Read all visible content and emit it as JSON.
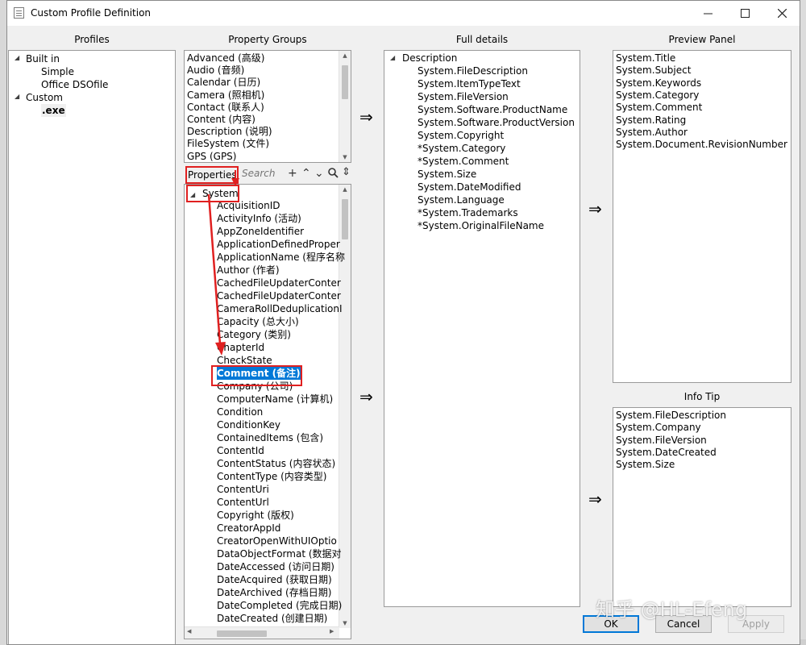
{
  "window": {
    "title": "Custom Profile Definition"
  },
  "columns": {
    "profiles": "Profiles",
    "property_groups": "Property Groups",
    "full_details": "Full details",
    "preview_panel": "Preview Panel",
    "info_tip": "Info Tip"
  },
  "profiles_tree": {
    "built_in": "Built in",
    "simple": "Simple",
    "office": "Office DSOfile",
    "custom": "Custom",
    "exe": ".exe"
  },
  "property_groups": [
    "Advanced (高级)",
    "Audio (音频)",
    "Calendar (日历)",
    "Camera (照相机)",
    "Contact (联系人)",
    "Content (内容)",
    "Description (说明)",
    "FileSystem (文件)",
    "GPS (GPS)"
  ],
  "properties_label": "Properties",
  "search_placeholder": "Search",
  "properties_tree": {
    "root": "System",
    "items": [
      "AcquisitionID",
      "ActivityInfo (活动)",
      "AppZoneIdentifier",
      "ApplicationDefinedProper",
      "ApplicationName (程序名称",
      "Author (作者)",
      "CachedFileUpdaterConter",
      "CachedFileUpdaterConter",
      "CameraRollDeduplicationI",
      "Capacity (总大小)",
      "Category (类别)",
      "ChapterId",
      "CheckState",
      "Comment (备注)",
      "Company (公司)",
      "ComputerName (计算机)",
      "Condition",
      "ConditionKey",
      "ContainedItems (包含)",
      "ContentId",
      "ContentStatus (内容状态)",
      "ContentType (内容类型)",
      "ContentUri",
      "ContentUrl",
      "Copyright (版权)",
      "CreatorAppId",
      "CreatorOpenWithUIOptio",
      "DataObjectFormat (数据对",
      "DateAccessed (访问日期)",
      "DateAcquired (获取日期)",
      "DateArchived (存档日期)",
      "DateCompleted (完成日期)",
      "DateCreated (创建日期)"
    ],
    "selected": "Comment (备注)"
  },
  "full_details": {
    "group": "Description",
    "items": [
      "System.FileDescription",
      "System.ItemTypeText",
      "System.FileVersion",
      "System.Software.ProductName",
      "System.Software.ProductVersion",
      "System.Copyright",
      "*System.Category",
      "*System.Comment",
      "System.Size",
      "System.DateModified",
      "System.Language",
      "*System.Trademarks",
      "*System.OriginalFileName"
    ]
  },
  "preview_panel": [
    "System.Title",
    "System.Subject",
    "System.Keywords",
    "System.Category",
    "System.Comment",
    "System.Rating",
    "System.Author",
    "System.Document.RevisionNumber"
  ],
  "info_tip": [
    "System.FileDescription",
    "System.Company",
    "System.FileVersion",
    "System.DateCreated",
    "System.Size"
  ],
  "buttons": {
    "ok": "OK",
    "cancel": "Cancel",
    "apply": "Apply"
  },
  "arrow_glyph": "⇒",
  "watermark": "知乎 @HL-Efeng",
  "colors": {
    "annotation_red": "#e02020",
    "selection_blue": "#0078d7"
  }
}
